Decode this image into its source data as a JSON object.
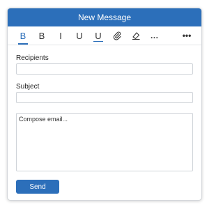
{
  "window": {
    "title": "New Message"
  },
  "toolbar": {
    "bold_label": "B",
    "italic_bold_label": "B",
    "italic_label": "I",
    "underline_label": "U",
    "underline_blue_label": "U",
    "attach_icon": "paperclip-icon",
    "highlight_icon": "highlighter-icon",
    "more_format_label": "…",
    "overflow_label": "•••"
  },
  "recipients": {
    "label": "Recipients",
    "value": ""
  },
  "subject": {
    "label": "Subject",
    "value": ""
  },
  "body": {
    "placeholder": "Compose email..."
  },
  "send": {
    "label": "Send"
  },
  "colors": {
    "accent": "#2c6fba"
  }
}
